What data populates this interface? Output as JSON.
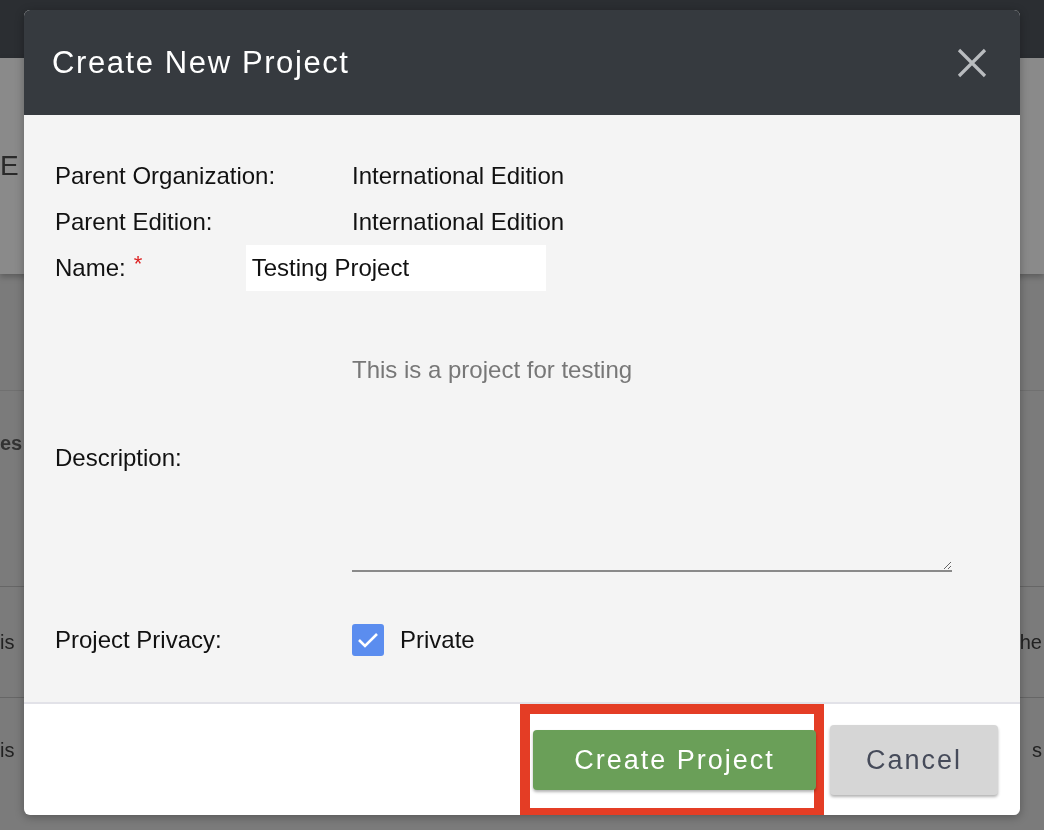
{
  "background": {
    "left_fragments": [
      "E",
      "es",
      "is",
      "is"
    ],
    "right_fragments": [
      "he",
      "s"
    ]
  },
  "dialog": {
    "title": "Create New Project",
    "fields": [
      {
        "kind": "text",
        "label": "Parent Organization:",
        "value": "International Edition"
      },
      {
        "kind": "text",
        "label": "Parent Edition:",
        "value": "International Edition"
      },
      {
        "kind": "input",
        "label": "Name:",
        "required_mark": "*",
        "value": "Testing Project"
      },
      {
        "kind": "textarea",
        "label": "Description:",
        "placeholder": "This is a project for testing"
      },
      {
        "kind": "checkbox",
        "label": "Project Privacy:",
        "option": "Private",
        "checked": true
      }
    ],
    "buttons": [
      {
        "kind": "primary",
        "label": "Create Project",
        "highlighted": true
      },
      {
        "kind": "secondary",
        "label": "Cancel"
      }
    ]
  }
}
